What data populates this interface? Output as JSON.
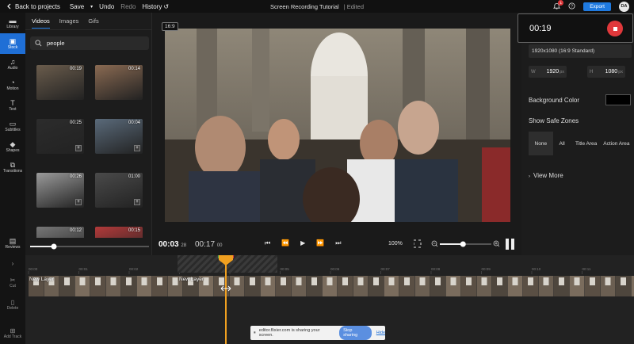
{
  "topbar": {
    "back": "Back to projects",
    "save": "Save",
    "undo": "Undo",
    "redo": "Redo",
    "history": "History",
    "project_title": "Screen Recording Tutorial",
    "edited": "| Edited",
    "notifications": "1",
    "export": "Export",
    "avatar": "DA"
  },
  "nav": [
    {
      "label": "Library",
      "icon": "folder-icon"
    },
    {
      "label": "Stock",
      "icon": "stock-icon"
    },
    {
      "label": "Audio",
      "icon": "music-icon"
    },
    {
      "label": "Motion",
      "icon": "motion-icon"
    },
    {
      "label": "Text",
      "icon": "text-icon"
    },
    {
      "label": "Subtitles",
      "icon": "subtitles-icon"
    },
    {
      "label": "Shapes",
      "icon": "shapes-icon"
    },
    {
      "label": "Transitions",
      "icon": "transitions-icon"
    }
  ],
  "nav_reviews": "Reviews",
  "media": {
    "tabs": [
      "Videos",
      "Images",
      "Gifs"
    ],
    "search_value": "people",
    "thumbs": [
      {
        "duration": "00:19",
        "color": "#6a5c4c"
      },
      {
        "duration": "00:14",
        "color": "#8a6a52"
      },
      {
        "duration": "00:25",
        "color": "#2c2c2c"
      },
      {
        "duration": "00:04",
        "color": "#5a6a7a"
      },
      {
        "duration": "00:26",
        "color": "#9a9a9a"
      },
      {
        "duration": "01:00",
        "color": "#4a4a4a"
      },
      {
        "duration": "00:12",
        "color": "#777777"
      },
      {
        "duration": "00:15",
        "color": "#b23a3a"
      }
    ],
    "thumb_zoom_level": 0.2
  },
  "preview": {
    "aspect_ratio": "16:9",
    "current_time": "00:03",
    "current_frames": "28",
    "total_time": "00:17",
    "total_frames": "00",
    "zoom": "100%",
    "zoom_level": 0.45
  },
  "right_panel": {
    "rec_time": "00:19",
    "resolution": "1920x1080 (16:9 Standard)",
    "width_label": "W",
    "width": "1920",
    "height_label": "H",
    "height": "1080",
    "unit": "px",
    "bg_color_label": "Background Color",
    "bg_color": "#000000",
    "safe_zones_label": "Show Safe Zones",
    "safe_zone_options": [
      "None",
      "All",
      "Title Area",
      "Action Area"
    ],
    "view_more": "View More"
  },
  "timeline": {
    "tools": [
      "Cut",
      "Delete",
      "Add Track"
    ],
    "ruler_marks": [
      "00:00",
      "00:01",
      "00:02",
      "00:03",
      "00:04",
      "00:05",
      "00:06",
      "00:07",
      "00:08",
      "00:09",
      "00:10",
      "00:11"
    ],
    "layers": [
      "New Layer",
      "New Layer"
    ]
  },
  "share_bar": {
    "message": "editor.flixier.com is sharing your screen.",
    "stop": "Stop sharing",
    "hide": "Hide"
  }
}
